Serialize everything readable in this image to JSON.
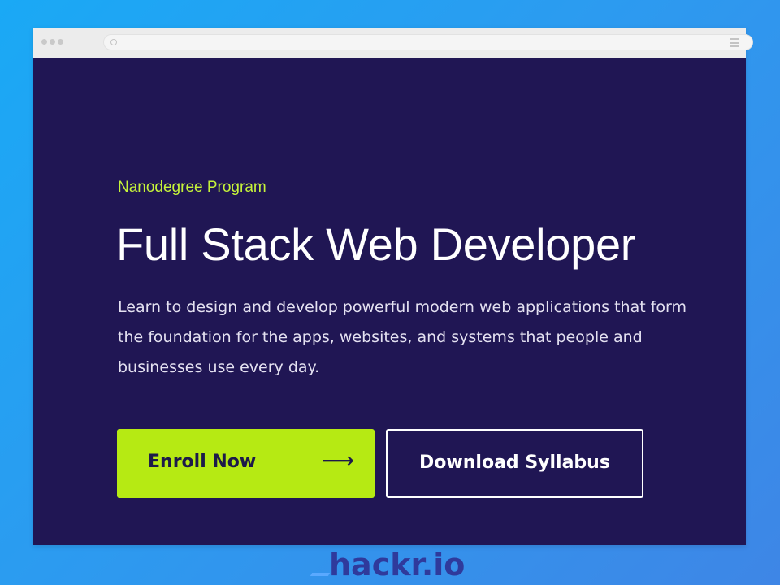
{
  "hero": {
    "eyebrow": "Nanodegree Program",
    "title": "Full Stack Web Developer",
    "description": "Learn to design and develop powerful modern web applications that form the foundation for the apps, websites, and systems that people and businesses use every day."
  },
  "buttons": {
    "enroll_label": "Enroll Now",
    "enroll_arrow": "⟶",
    "syllabus_label": "Download Syllabus"
  },
  "watermark": {
    "text": "hackr.io"
  },
  "colors": {
    "background_gradient_start": "#1aa9f5",
    "background_gradient_end": "#3e86e6",
    "hero_background": "#201654",
    "accent": "#b6ea13",
    "eyebrow": "#c5f23a",
    "logo": "#2f3a9c"
  },
  "icons": {
    "window_controls": "dots-icon",
    "address_bar_indicator": "circle-icon",
    "browser_menu": "hamburger-menu-icon",
    "enroll_arrow": "arrow-right-icon"
  }
}
